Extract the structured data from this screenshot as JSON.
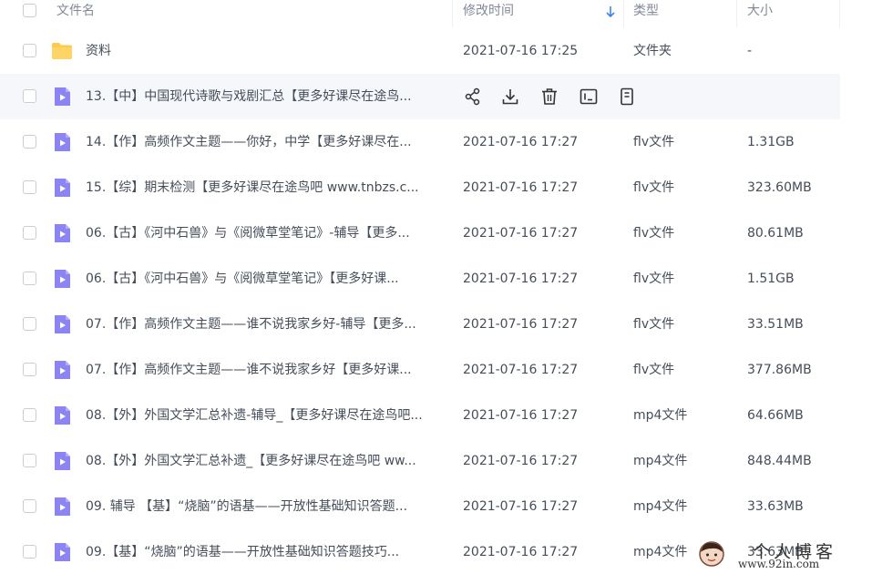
{
  "header": {
    "name": "文件名",
    "modified": "修改时间",
    "type": "类型",
    "size": "大小"
  },
  "rows": [
    {
      "name": "资料",
      "time": "2021-07-16 17:25",
      "type": "文件夹",
      "size": "-",
      "kind": "folder"
    },
    {
      "name": "13.【中】中国现代诗歌与戏剧汇总【更多好课尽在途鸟...",
      "time": "",
      "type": "",
      "size": "",
      "kind": "video",
      "hover": true
    },
    {
      "name": "14.【作】高频作文主题——你好，中学【更多好课尽在...",
      "time": "2021-07-16 17:27",
      "type": "flv文件",
      "size": "1.31GB",
      "kind": "video"
    },
    {
      "name": "15.【综】期末检测【更多好课尽在途鸟吧 www.tnbzs.c...",
      "time": "2021-07-16 17:27",
      "type": "flv文件",
      "size": "323.60MB",
      "kind": "video"
    },
    {
      "name": "06.【古】《河中石兽》与《阅微草堂笔记》-辅导【更多...",
      "time": "2021-07-16 17:27",
      "type": "flv文件",
      "size": "80.61MB",
      "kind": "video"
    },
    {
      "name": "06.【古】《河中石兽》与《阅微草堂笔记》【更多好课...",
      "time": "2021-07-16 17:27",
      "type": "flv文件",
      "size": "1.51GB",
      "kind": "video"
    },
    {
      "name": "07.【作】高频作文主题——谁不说我家乡好-辅导【更多...",
      "time": "2021-07-16 17:27",
      "type": "flv文件",
      "size": "33.51MB",
      "kind": "video"
    },
    {
      "name": "07.【作】高频作文主题——谁不说我家乡好【更多好课...",
      "time": "2021-07-16 17:27",
      "type": "flv文件",
      "size": "377.86MB",
      "kind": "video"
    },
    {
      "name": "08.【外】外国文学汇总补遗-辅导_【更多好课尽在途鸟吧...",
      "time": "2021-07-16 17:27",
      "type": "mp4文件",
      "size": "64.66MB",
      "kind": "video"
    },
    {
      "name": "08.【外】外国文学汇总补遗_【更多好课尽在途鸟吧 ww...",
      "time": "2021-07-16 17:27",
      "type": "mp4文件",
      "size": "848.44MB",
      "kind": "video"
    },
    {
      "name": "09. 辅导 【基】“烧脑”的语基——开放性基础知识答题...",
      "time": "2021-07-16 17:27",
      "type": "mp4文件",
      "size": "33.63MB",
      "kind": "video"
    },
    {
      "name": "09.【基】“烧脑”的语基——开放性基础知识答题技巧...",
      "time": "2021-07-16 17:27",
      "type": "mp4文件",
      "size": "33.63MB",
      "kind": "video"
    }
  ],
  "icons": {
    "share": "share-icon",
    "download": "download-icon",
    "delete": "trash-icon",
    "rename": "rename-icon",
    "more": "copy-icon"
  },
  "colors": {
    "folder": "#ffc94d",
    "video": "#8b84f2",
    "sort_arrow": "#3b82f6"
  },
  "watermark": {
    "title": "个人博客",
    "url": "www.92in.com"
  }
}
